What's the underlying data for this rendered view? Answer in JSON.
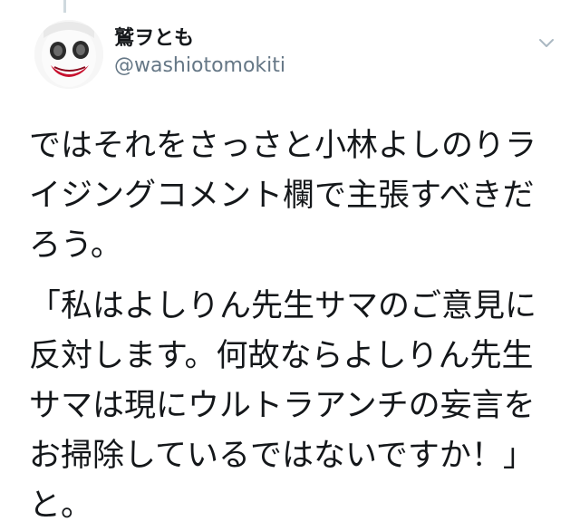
{
  "tweet": {
    "display_name": "鷲ヲとも",
    "handle": "@washiotomokiti",
    "menu_icon": "chevron-down-icon",
    "avatar_icon": "joker-face-avatar",
    "paragraph1": [
      "ではそれをさっさと小林よしのりラ",
      "イジングコメント欄で主張すべきだ",
      "ろう。"
    ],
    "paragraph2": [
      "「私はよしりん先生サマのご意見に",
      "反対します。何故ならよしりん先生",
      "サマは現にウルトラアンチの妄言を",
      "お掃除しているではないですか！」",
      "と。"
    ]
  }
}
